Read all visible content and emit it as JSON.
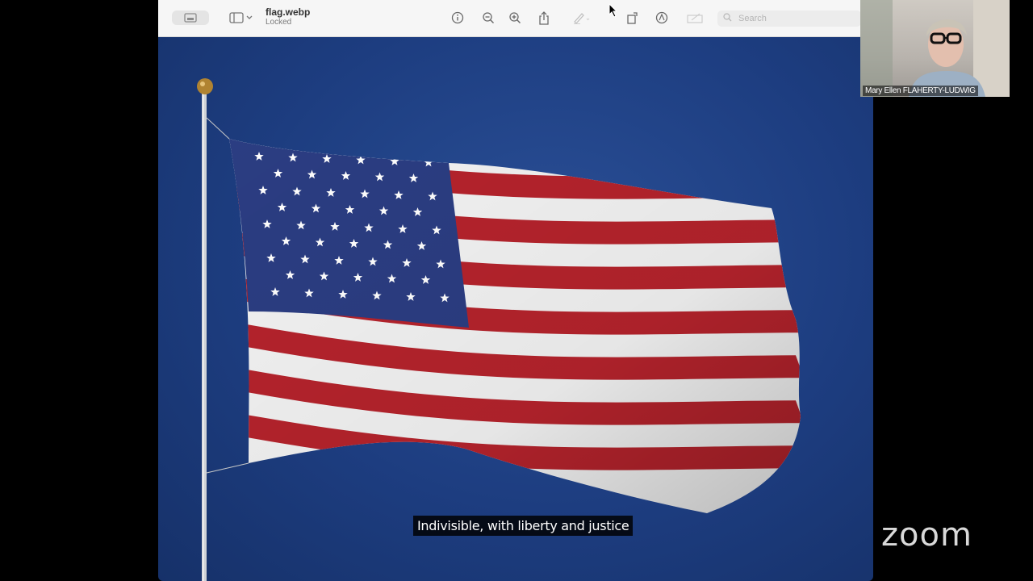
{
  "window": {
    "file_name": "flag.webp",
    "file_status": "Locked"
  },
  "toolbar": {
    "buttons": [
      {
        "name": "markup-toolbar-toggle-icon"
      },
      {
        "name": "sidebar-toggle-icon"
      },
      {
        "name": "info-icon"
      },
      {
        "name": "zoom-out-icon"
      },
      {
        "name": "zoom-in-icon"
      },
      {
        "name": "share-icon"
      },
      {
        "name": "highlight-pen-icon"
      },
      {
        "name": "rotate-icon"
      },
      {
        "name": "markup-icon"
      },
      {
        "name": "signature-icon"
      }
    ]
  },
  "search": {
    "placeholder": "Search",
    "value": ""
  },
  "subtitle": {
    "text": "Indivisible, with liberty and justice"
  },
  "participant": {
    "name": "Mary Ellen FLAHERTY-LUDWIG"
  },
  "branding": {
    "app_logo": "zoom"
  },
  "colors": {
    "sky_blue": "#1d3d80",
    "flag_red": "#b5232c",
    "flag_white": "#f3f3f3",
    "canton_blue": "#2b3d82"
  }
}
